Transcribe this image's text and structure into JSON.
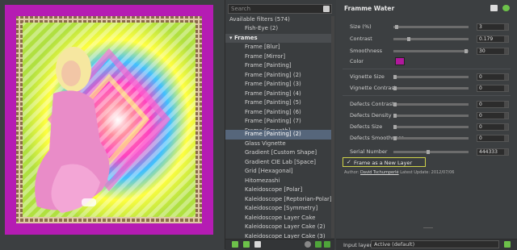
{
  "search": {
    "placeholder": "Search"
  },
  "filter_list": {
    "available": "Available filters (574)",
    "items": [
      {
        "label": "Fish-Eye (2)",
        "type": "item"
      },
      {
        "label": "Frames",
        "type": "category",
        "expander": "▾"
      },
      {
        "label": "Frame [Blur]",
        "type": "item"
      },
      {
        "label": "Frame [Mirror]",
        "type": "item"
      },
      {
        "label": "Frame [Painting]",
        "type": "item"
      },
      {
        "label": "Frame [Painting] (2)",
        "type": "item"
      },
      {
        "label": "Frame [Painting] (3)",
        "type": "item"
      },
      {
        "label": "Frame [Painting] (4)",
        "type": "item"
      },
      {
        "label": "Frame [Painting] (5)",
        "type": "item"
      },
      {
        "label": "Frame [Painting] (6)",
        "type": "item"
      },
      {
        "label": "Frame [Painting] (7)",
        "type": "item"
      },
      {
        "label": "Frame [Smooth]",
        "type": "item"
      },
      {
        "label": "Frame [Painting] (2)",
        "type": "selected"
      },
      {
        "label": "Glass Vignette",
        "type": "item"
      },
      {
        "label": "Gradient [Custom Shape]",
        "type": "item"
      },
      {
        "label": "Gradient CIE Lab [Space]",
        "type": "item"
      },
      {
        "label": "Grid [Hexagonal]",
        "type": "item"
      },
      {
        "label": "Hitomezashi",
        "type": "item"
      },
      {
        "label": "Kaleidoscope [Polar]",
        "type": "item"
      },
      {
        "label": "Kaleidoscope [Reptorian-Polar]",
        "type": "item"
      },
      {
        "label": "Kaleidoscope [Symmetry]",
        "type": "item"
      },
      {
        "label": "Kaleidoscope Layer Cake",
        "type": "item"
      },
      {
        "label": "Kaleidoscope Layer Cake (2)",
        "type": "item"
      },
      {
        "label": "Kaleidoscope Layer Cake (3)",
        "type": "item"
      }
    ]
  },
  "params": {
    "title": "Framme Water",
    "size": {
      "label": "Size (%)",
      "value": "3",
      "fraction": 0.03
    },
    "contrast": {
      "label": "Contrast",
      "value": "0.179",
      "fraction": 0.18
    },
    "smoothness": {
      "label": "Smoothness",
      "value": "30",
      "fraction": 0.97
    },
    "color": {
      "label": "Color",
      "hex": "#b0189c"
    },
    "vignette_size": {
      "label": "Vignette Size",
      "value": "0",
      "fraction": 0
    },
    "vignette_contrast": {
      "label": "Vignette Contrast",
      "value": "0",
      "fraction": 0
    },
    "defects_contrast": {
      "label": "Defects Contrast",
      "value": "0",
      "fraction": 0
    },
    "defects_density": {
      "label": "Defects Density",
      "value": "0",
      "fraction": 0
    },
    "defects_size": {
      "label": "Defects Size",
      "value": "0",
      "fraction": 0
    },
    "defects_smoothness": {
      "label": "Defects Smoothness",
      "value": "0",
      "fraction": 0
    },
    "serial": {
      "label": "Serial Number",
      "value": "444333",
      "fraction": 0.44
    },
    "frame_layer": {
      "check": "✓",
      "label": "Frame as a New Layer"
    },
    "author": {
      "prefix": "Author:",
      "name": "David Tschumperlé",
      "update": "Latest Update: 2012/07/06"
    }
  },
  "bottom": {
    "input_layers_label": "Input layers",
    "input_layers_value": "Active (default)"
  },
  "colors": {
    "accent_frame": "#b51cb3",
    "selection": "#56667b",
    "checkbox_border": "#cfd24a"
  }
}
